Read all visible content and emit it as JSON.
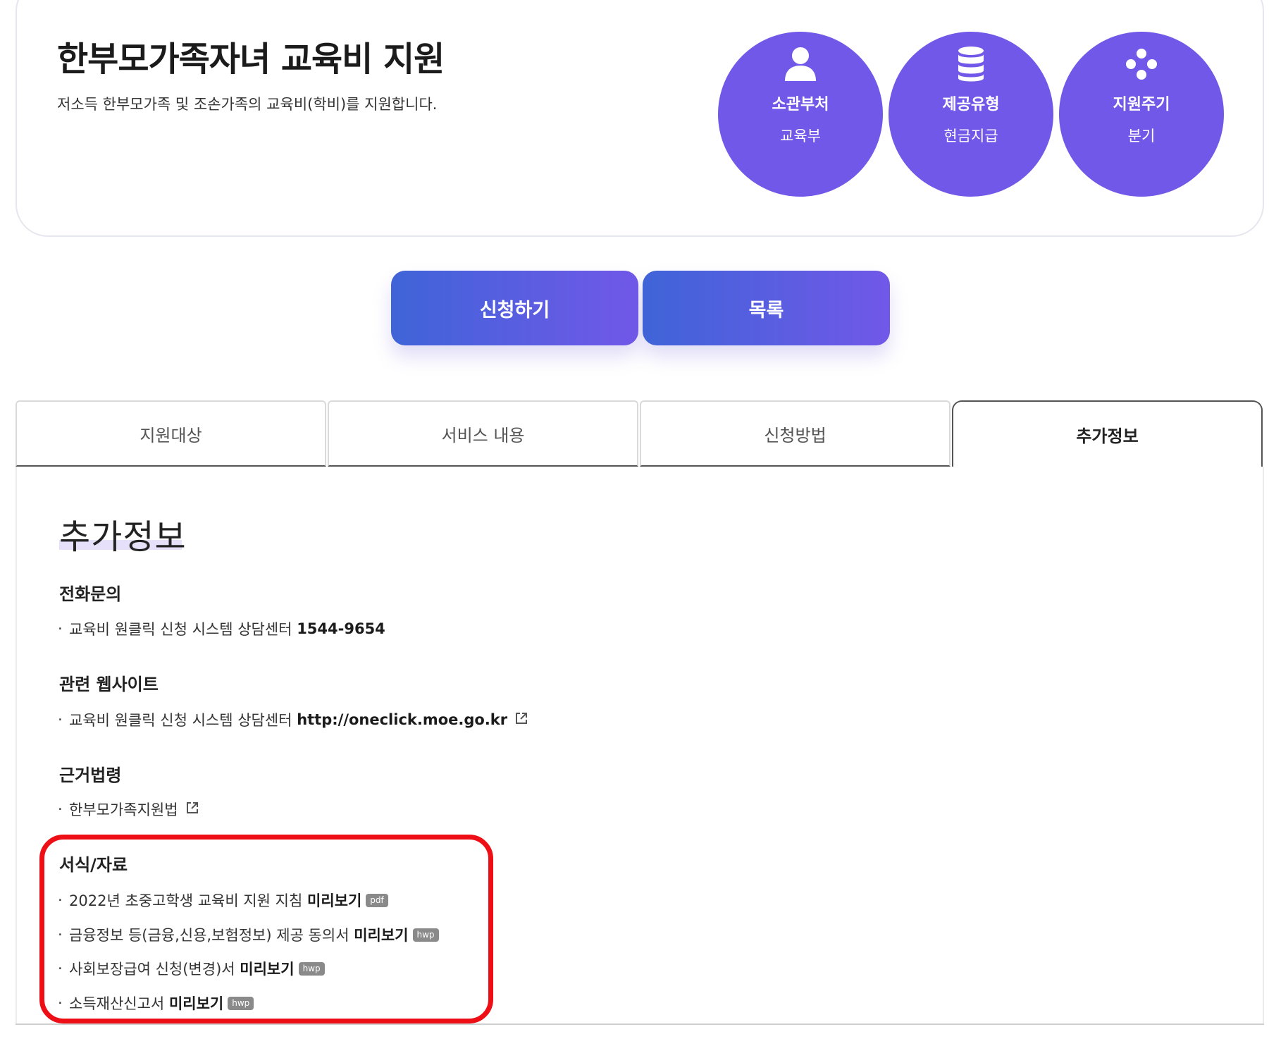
{
  "header": {
    "title": "한부모가족자녀 교육비 지원",
    "description": "저소득 한부모가족 및 조손가족의 교육비(학비)를 지원합니다.",
    "badges": [
      {
        "icon": "person-icon",
        "label": "소관부처",
        "value": "교육부"
      },
      {
        "icon": "database-icon",
        "label": "제공유형",
        "value": "현금지급"
      },
      {
        "icon": "cycle-dots-icon",
        "label": "지원주기",
        "value": "분기"
      }
    ],
    "accent_color": "#7158e8"
  },
  "actions": {
    "apply_label": "신청하기",
    "list_label": "목록"
  },
  "tabs": [
    {
      "label": "지원대상",
      "active": false
    },
    {
      "label": "서비스 내용",
      "active": false
    },
    {
      "label": "신청방법",
      "active": false
    },
    {
      "label": "추가정보",
      "active": true
    }
  ],
  "content": {
    "title": "추가정보",
    "sections": [
      {
        "heading": "전화문의",
        "items": [
          {
            "text": "교육비 원클릭 신청 시스템 상담센터",
            "strong": "1544-9654"
          }
        ]
      },
      {
        "heading": "관련 웹사이트",
        "items": [
          {
            "text": "교육비 원클릭 신청 시스템 상담센터",
            "strong": "http://oneclick.moe.go.kr",
            "external": true
          }
        ]
      },
      {
        "heading": "근거법령",
        "items": [
          {
            "text": "한부모가족지원법",
            "external": true
          }
        ]
      },
      {
        "heading": "서식/자료",
        "items": [
          {
            "text": "2022년 초중고학생 교육비 지원 지침",
            "strong": "미리보기",
            "badge": "pdf"
          },
          {
            "text": "금융정보 등(금융,신용,보험정보) 제공 동의서",
            "strong": "미리보기",
            "badge": "hwp"
          },
          {
            "text": "사회보장급여 신청(변경)서",
            "strong": "미리보기",
            "badge": "hwp"
          },
          {
            "text": "소득재산신고서",
            "strong": "미리보기",
            "badge": "hwp"
          }
        ]
      }
    ]
  },
  "annotation_color": "#ee0f16"
}
